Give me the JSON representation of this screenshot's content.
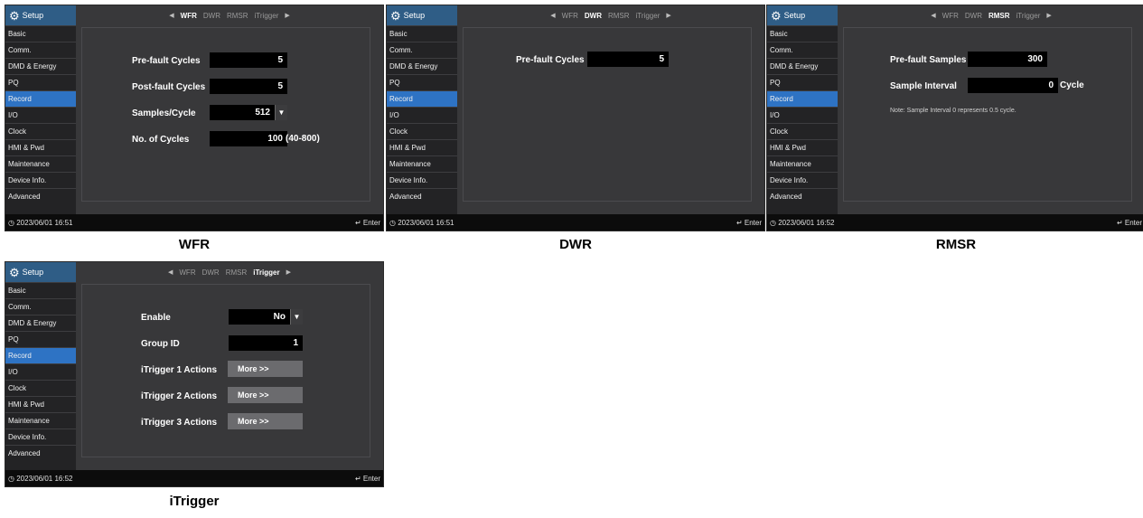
{
  "sidebar": {
    "title": "Setup",
    "items": [
      "Basic",
      "Comm.",
      "DMD & Energy",
      "PQ",
      "Record",
      "I/O",
      "Clock",
      "HMI & Pwd",
      "Maintenance",
      "Device Info.",
      "Advanced"
    ],
    "active": "Record"
  },
  "tabs": [
    "WFR",
    "DWR",
    "RMSR",
    "iTrigger"
  ],
  "footer": {
    "enter": "Enter"
  },
  "screens": {
    "wfr": {
      "caption": "WFR",
      "datetime": "2023/06/01 16:51",
      "prefault_label": "Pre-fault Cycles",
      "prefault_value": "5",
      "postfault_label": "Post-fault Cycles",
      "postfault_value": "5",
      "samples_label": "Samples/Cycle",
      "samples_value": "512",
      "cycles_label": "No. of Cycles",
      "cycles_value": "100",
      "cycles_range": "(40-800)"
    },
    "dwr": {
      "caption": "DWR",
      "datetime": "2023/06/01 16:51",
      "prefault_label": "Pre-fault Cycles",
      "prefault_value": "5"
    },
    "rmsr": {
      "caption": "RMSR",
      "datetime": "2023/06/01 16:52",
      "prefault_label": "Pre-fault Samples",
      "prefault_value": "300",
      "interval_label": "Sample Interval",
      "interval_value": "0",
      "interval_unit": "Cycle",
      "note": "Note: Sample Interval 0 represents 0.5 cycle."
    },
    "itrigger": {
      "caption": "iTrigger",
      "datetime": "2023/06/01 16:52",
      "enable_label": "Enable",
      "enable_value": "No",
      "group_label": "Group ID",
      "group_value": "1",
      "action1_label": "iTrigger 1 Actions",
      "action2_label": "iTrigger 2 Actions",
      "action3_label": "iTrigger 3 Actions",
      "more_label": "More >>"
    }
  },
  "icons": {
    "gear": "gear-icon",
    "clock": "clock-icon",
    "enter": "enter-icon",
    "left": "left-arrow-icon",
    "right": "right-arrow-icon",
    "dropdown": "dropdown-arrow-icon"
  },
  "colors": {
    "sidebar_active": "#2e73c4",
    "header": "#2f5d86",
    "panel_bg": "#38383a",
    "value_bg": "#000000"
  }
}
